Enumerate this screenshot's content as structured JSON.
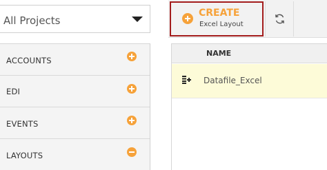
{
  "project_select": {
    "value": "All Projects"
  },
  "sidebar": {
    "items": [
      {
        "label": "ACCOUNTS",
        "icon": "plus-circle-icon"
      },
      {
        "label": "EDI",
        "icon": "plus-circle-icon"
      },
      {
        "label": "EVENTS",
        "icon": "plus-circle-icon"
      },
      {
        "label": "LAYOUTS",
        "icon": "minus-circle-icon"
      }
    ]
  },
  "toolbar": {
    "create_label": "CREATE",
    "create_sub": "Excel Layout",
    "refresh_icon": "refresh-icon"
  },
  "table": {
    "columns": [
      "NAME"
    ],
    "rows": [
      {
        "name": "Datafile_Excel",
        "icon": "excel-file-icon"
      }
    ]
  },
  "colors": {
    "accent": "#f6a23a",
    "create_border": "#a31c1c",
    "row_highlight": "#fdfbd8"
  }
}
